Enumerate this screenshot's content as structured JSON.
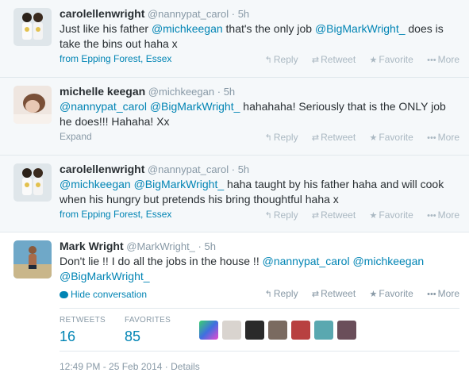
{
  "tweets": [
    {
      "fullname": "carolellenwright",
      "handle": "@nannypat_carol",
      "time": "5h",
      "text": {
        "p1": "Just like his father ",
        "m1": "@michkeegan",
        "p2": " that's the only job ",
        "m2": "@BigMarkWright_",
        "p3": " does is take the bins out haha x"
      },
      "meta": "from Epping Forest, Essex"
    },
    {
      "fullname": "michelle keegan",
      "handle": "@michkeegan",
      "time": "5h",
      "text": {
        "m1": "@nannypat_carol",
        "s1": " ",
        "m2": "@BigMarkWright_",
        "p1": " hahahaha! Seriously that is the ONLY job he does!!! Hahaha! Xx"
      },
      "meta": "Expand"
    },
    {
      "fullname": "carolellenwright",
      "handle": "@nannypat_carol",
      "time": "5h",
      "text": {
        "m1": "@michkeegan",
        "s1": " ",
        "m2": "@BigMarkWright_",
        "p1": " haha taught by his father haha and will cook when his hungry but pretends his bring thoughtful haha x"
      },
      "meta": "from Epping Forest, Essex"
    },
    {
      "fullname": "Mark Wright",
      "handle": "@MarkWright_",
      "time": "5h",
      "text": {
        "p1": "Don't lie !! I do all the jobs in the house !!  ",
        "m1": "@nannypat_carol",
        "s1": " ",
        "m2": "@michkeegan",
        "s2": " ",
        "m3": "@BigMarkWright_"
      },
      "meta": "Hide conversation",
      "stats": {
        "retweets_label": "RETWEETS",
        "retweets_value": "16",
        "favorites_label": "FAVORITES",
        "favorites_value": "85"
      },
      "timestamp": "12:49 PM - 25 Feb 2014",
      "details": "Details"
    }
  ],
  "actions": {
    "reply": "Reply",
    "retweet": "Retweet",
    "favorite": "Favorite",
    "more": "More"
  },
  "icons": {
    "reply": "reply-icon",
    "retweet": "retweet-icon",
    "favorite": "star-icon",
    "more": "more-dots-icon",
    "conversation": "speech-bubble-icon"
  },
  "colors": {
    "link": "#0084b4",
    "muted": "#8899a6",
    "faint": "#aab8c2",
    "conversation_bg": "#f5f8fa"
  }
}
